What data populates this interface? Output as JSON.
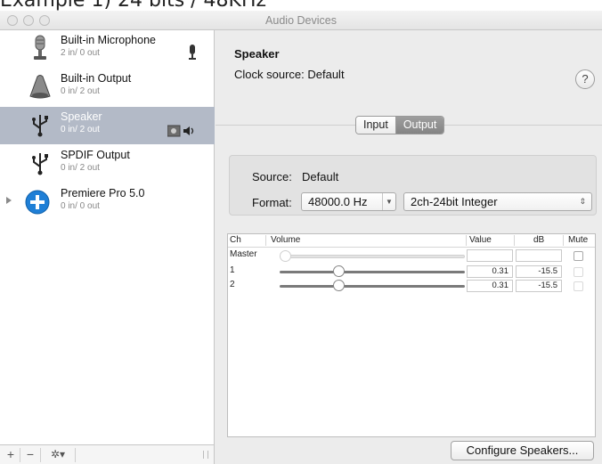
{
  "caption": "Example 1) 24 bits / 48KHz",
  "window": {
    "title": "Audio Devices"
  },
  "sidebar": {
    "devices": [
      {
        "name": "Built-in Microphone",
        "io": "2 in/ 0 out",
        "icon": "microphone-icon"
      },
      {
        "name": "Built-in Output",
        "io": "0 in/ 2 out",
        "icon": "speaker-icon"
      },
      {
        "name": "Speaker",
        "io": "0 in/ 2 out",
        "icon": "usb-icon",
        "selected": true
      },
      {
        "name": "SPDIF Output",
        "io": "0 in/ 2 out",
        "icon": "usb-icon"
      },
      {
        "name": "Premiere Pro 5.0",
        "io": "0 in/ 0 out",
        "icon": "aggregate-plus-icon"
      }
    ],
    "toolbar": {
      "add": "+",
      "remove": "−",
      "gear": "✲▾"
    }
  },
  "detail": {
    "device_name": "Speaker",
    "clock_source": "Clock source: Default",
    "help": "?",
    "tabs": [
      "Input",
      "Output"
    ],
    "active_tab": "Output",
    "source_label": "Source:",
    "source_value": "Default",
    "format_label": "Format:",
    "sample_rate": "48000.0 Hz",
    "bit_format": "2ch-24bit Integer",
    "table": {
      "headers": {
        "ch": "Ch",
        "volume": "Volume",
        "value": "Value",
        "db": "dB",
        "mute": "Mute"
      },
      "rows": [
        {
          "ch": "Master",
          "level": 0,
          "value": "",
          "db": "",
          "enabled": false
        },
        {
          "ch": "1",
          "level": 0.31,
          "value": "0.31",
          "db": "-15.5",
          "enabled": true
        },
        {
          "ch": "2",
          "level": 0.31,
          "value": "0.31",
          "db": "-15.5",
          "enabled": true
        }
      ]
    },
    "configure_button": "Configure Speakers..."
  },
  "colors": {
    "selection": "#b3bac7",
    "segment_active": "#8e8e8e",
    "panel": "#ececec"
  }
}
